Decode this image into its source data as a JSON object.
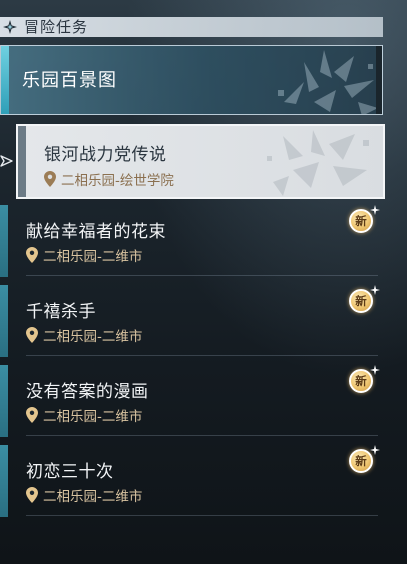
{
  "header": {
    "title": "冒险任务",
    "icon": "diamond-star-icon"
  },
  "category": {
    "label": "乐园百景图"
  },
  "selected_quest": {
    "title": "银河战力党传说",
    "location": "二相乐园-绘世学院",
    "icon": "location-pin-icon"
  },
  "quests": [
    {
      "title": "献给幸福者的花束",
      "location": "二相乐园-二维市",
      "badge": "新"
    },
    {
      "title": "千禧杀手",
      "location": "二相乐园-二维市",
      "badge": "新"
    },
    {
      "title": "没有答案的漫画",
      "location": "二相乐园-二维市",
      "badge": "新"
    },
    {
      "title": "初恋三十次",
      "location": "二相乐园-二维市",
      "badge": "新"
    }
  ],
  "colors": {
    "accent_cyan": "#3b8ea3",
    "location_text": "#d8c3a0",
    "badge_gold": "#efc671"
  }
}
